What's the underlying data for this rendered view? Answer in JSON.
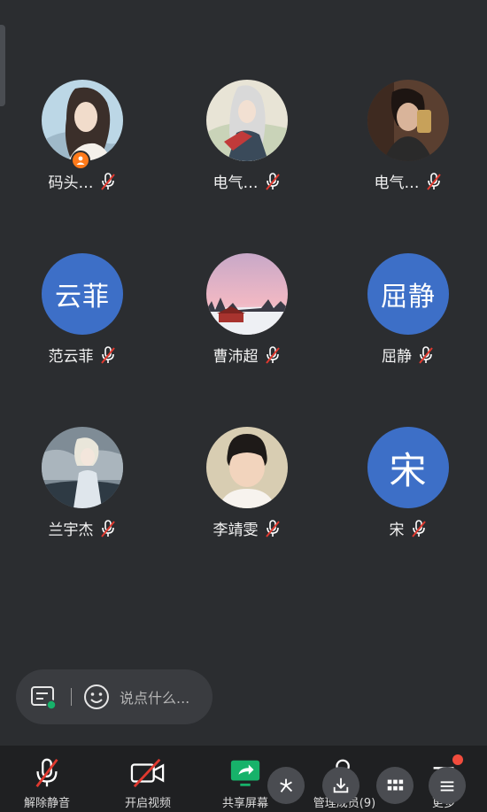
{
  "participants": [
    {
      "name": "码头…",
      "avatar": "photo-portrait-man-longhair",
      "host": true,
      "muted": true
    },
    {
      "name": "电气…",
      "avatar": "photo-anime-warrior",
      "host": false,
      "muted": true
    },
    {
      "name": "电气…",
      "avatar": "photo-selfie-man",
      "host": false,
      "muted": true
    },
    {
      "name": "范云菲",
      "avatar_text": "云菲",
      "host": false,
      "muted": true
    },
    {
      "name": "曹沛超",
      "avatar": "photo-pink-sky-cabin",
      "host": false,
      "muted": true
    },
    {
      "name": "屈静",
      "avatar_text": "屈静",
      "host": false,
      "muted": true
    },
    {
      "name": "兰宇杰",
      "avatar": "photo-anime-boy-sky",
      "host": false,
      "muted": true
    },
    {
      "name": "李靖雯",
      "avatar": "photo-child",
      "host": false,
      "muted": true
    },
    {
      "name": "宋",
      "avatar_text": "宋",
      "host": false,
      "muted": true
    }
  ],
  "chat": {
    "placeholder": "说点什么..."
  },
  "toolbar": {
    "unmute_label": "解除静音",
    "video_label": "开启视频",
    "share_label": "共享屏幕",
    "participants_label": "管理成员(9)",
    "more_label": "更多"
  },
  "colors": {
    "background": "#2b2d30",
    "avatar_blue": "#3d6fc7",
    "mute_red": "#e0392f",
    "host_orange": "#ff7a1a",
    "share_green": "#17b26a"
  }
}
